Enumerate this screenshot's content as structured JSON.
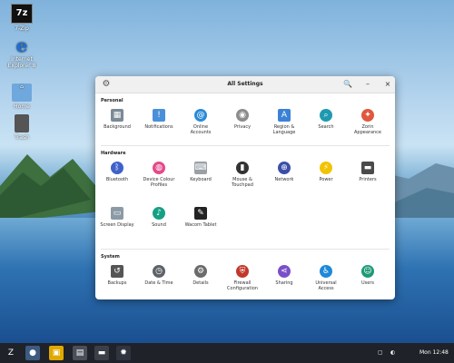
{
  "desktop": {
    "icons": [
      {
        "label": "7-Zip",
        "glyph": "7z"
      },
      {
        "label": "Internet Explorer 8",
        "glyph": "e"
      },
      {
        "label": "Home",
        "glyph": "⌂"
      },
      {
        "label": "Trash",
        "glyph": ""
      }
    ]
  },
  "window": {
    "title": "All Settings",
    "buttons": {
      "search": "🔍",
      "minimize": "–",
      "close": "×"
    },
    "sections": [
      {
        "heading": "Personal",
        "items": [
          {
            "label": "Background",
            "icon": "background-icon",
            "color": "#7a8a96"
          },
          {
            "label": "Notifications",
            "icon": "notifications-icon",
            "color": "#4a90d9"
          },
          {
            "label": "Online Accounts",
            "icon": "online-accounts-icon",
            "color": "#2a8ad6"
          },
          {
            "label": "Privacy",
            "icon": "privacy-icon",
            "color": "#8c8c8c"
          },
          {
            "label": "Region & Language",
            "icon": "region-icon",
            "color": "#3b82d6"
          },
          {
            "label": "Search",
            "icon": "search-icon",
            "color": "#1e9ab0"
          },
          {
            "label": "Zorin Appearance",
            "icon": "appearance-icon",
            "color": "#e0583d"
          }
        ]
      },
      {
        "heading": "Hardware",
        "items": [
          {
            "label": "Bluetooth",
            "icon": "bluetooth-icon",
            "color": "#3f62c9"
          },
          {
            "label": "Device Colour Profiles",
            "icon": "color-profiles-icon",
            "color": "#e34b8b"
          },
          {
            "label": "Keyboard",
            "icon": "keyboard-icon",
            "color": "#9aa0a6"
          },
          {
            "label": "Mouse & Touchpad",
            "icon": "mouse-icon",
            "color": "#333333"
          },
          {
            "label": "Network",
            "icon": "network-icon",
            "color": "#3c4ea8"
          },
          {
            "label": "Power",
            "icon": "power-icon",
            "color": "#f2c300"
          },
          {
            "label": "Printers",
            "icon": "printer-icon",
            "color": "#4a4a4a"
          },
          {
            "label": "Screen Display",
            "icon": "display-icon",
            "color": "#8c9aa6"
          },
          {
            "label": "Sound",
            "icon": "sound-icon",
            "color": "#16a085"
          },
          {
            "label": "Wacom Tablet",
            "icon": "tablet-icon",
            "color": "#222222"
          }
        ]
      },
      {
        "heading": "System",
        "items": [
          {
            "label": "Backups",
            "icon": "backup-icon",
            "color": "#555555"
          },
          {
            "label": "Date & Time",
            "icon": "clock-icon",
            "color": "#5f6368"
          },
          {
            "label": "Details",
            "icon": "gear-icon",
            "color": "#6b6b6b"
          },
          {
            "label": "Firewall Configuration",
            "icon": "firewall-icon",
            "color": "#c0392b"
          },
          {
            "label": "Sharing",
            "icon": "sharing-icon",
            "color": "#7b4fc9"
          },
          {
            "label": "Universal Access",
            "icon": "accessibility-icon",
            "color": "#1e88d9"
          },
          {
            "label": "Users",
            "icon": "users-icon",
            "color": "#1d9a78"
          }
        ]
      }
    ]
  },
  "taskbar": {
    "clock": "Mon 12:48",
    "apps": [
      {
        "name": "zorin-menu-icon",
        "glyph": "Z"
      },
      {
        "name": "browser-icon",
        "glyph": "●"
      },
      {
        "name": "store-icon",
        "glyph": "▣"
      },
      {
        "name": "files-icon",
        "glyph": "▤"
      },
      {
        "name": "terminal-icon",
        "glyph": "▬"
      },
      {
        "name": "settings-icon",
        "glyph": "✹"
      }
    ]
  }
}
